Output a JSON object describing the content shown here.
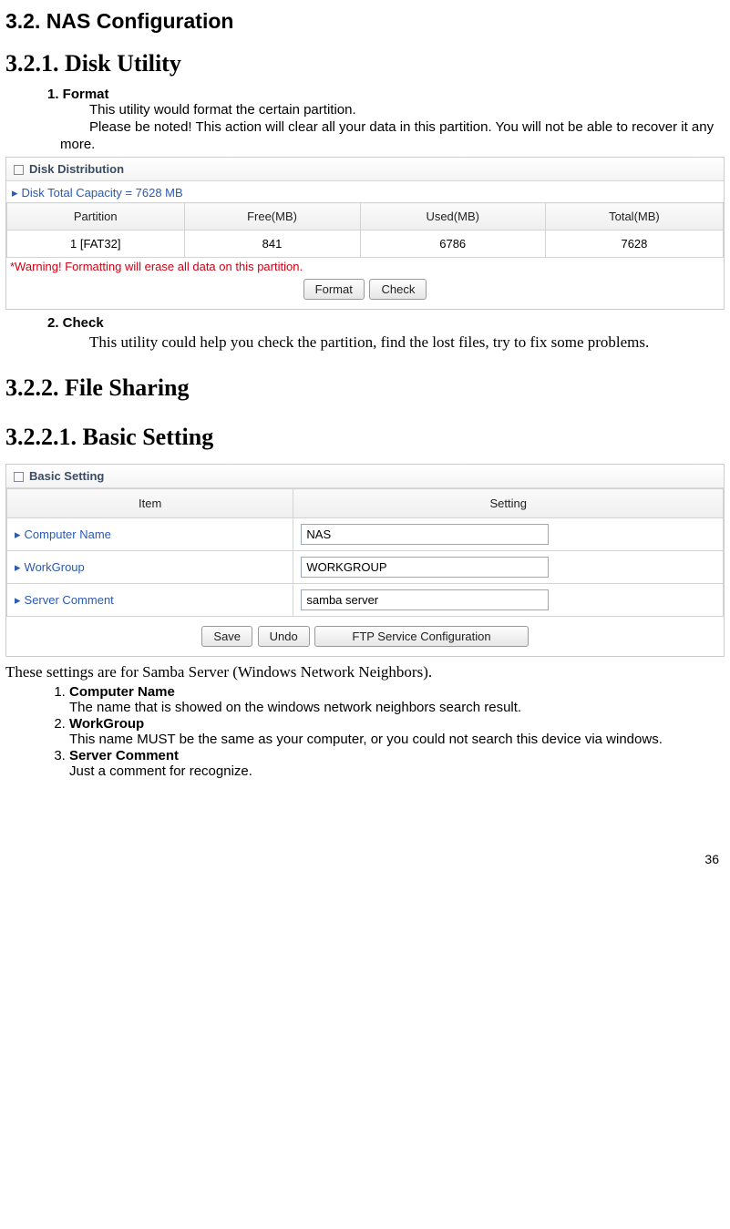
{
  "h_main": "3.2. NAS Configuration",
  "h_321": "3.2.1.   Disk Utility",
  "s1": {
    "label": "1. Format",
    "l1": "This utility would format the certain partition.",
    "l2": "Please be noted! This action will clear all your data in this partition. You will not be able to recover it any more."
  },
  "disk": {
    "title": "Disk Distribution",
    "capacity_label": "Disk Total Capacity = 7628 MB",
    "headers": {
      "partition": "Partition",
      "free": "Free(MB)",
      "used": "Used(MB)",
      "total": "Total(MB)"
    },
    "row": {
      "partition": "1 [FAT32]",
      "free": "841",
      "used": "6786",
      "total": "7628"
    },
    "warn": "*Warning! Formatting will erase all data on this partition.",
    "btn_format": "Format",
    "btn_check": "Check"
  },
  "s2": {
    "label": "2. Check",
    "text": "This utility could help you check the partition, find the lost files, try to fix some problems."
  },
  "h_322": "3.2.2.   File Sharing",
  "h_3221": "3.2.2.1.      Basic Setting",
  "basic": {
    "title": "Basic Setting",
    "headers": {
      "item": "Item",
      "setting": "Setting"
    },
    "rows": {
      "computer": {
        "label": "Computer Name",
        "value": "NAS"
      },
      "workgroup": {
        "label": "WorkGroup",
        "value": "WORKGROUP"
      },
      "comment": {
        "label": "Server Comment",
        "value": "samba server"
      }
    },
    "btn_save": "Save",
    "btn_undo": "Undo",
    "btn_ftp": "FTP Service Configuration"
  },
  "after": "These settings are for Samba Server (Windows Network Neighbors).",
  "defs": {
    "i1t": "Computer Name",
    "i1d": "The name that is showed on the windows network neighbors search result.",
    "i2t": "WorkGroup",
    "i2d": "This name MUST be the same as your computer, or you could not search this device via windows.",
    "i3t": "Server Comment",
    "i3d": "Just a comment for recognize."
  },
  "pagenum": "36",
  "chart_data": {
    "type": "table",
    "title": "Disk Distribution",
    "columns": [
      "Partition",
      "Free(MB)",
      "Used(MB)",
      "Total(MB)"
    ],
    "rows": [
      [
        "1 [FAT32]",
        841,
        6786,
        7628
      ]
    ],
    "total_capacity_mb": 7628
  }
}
